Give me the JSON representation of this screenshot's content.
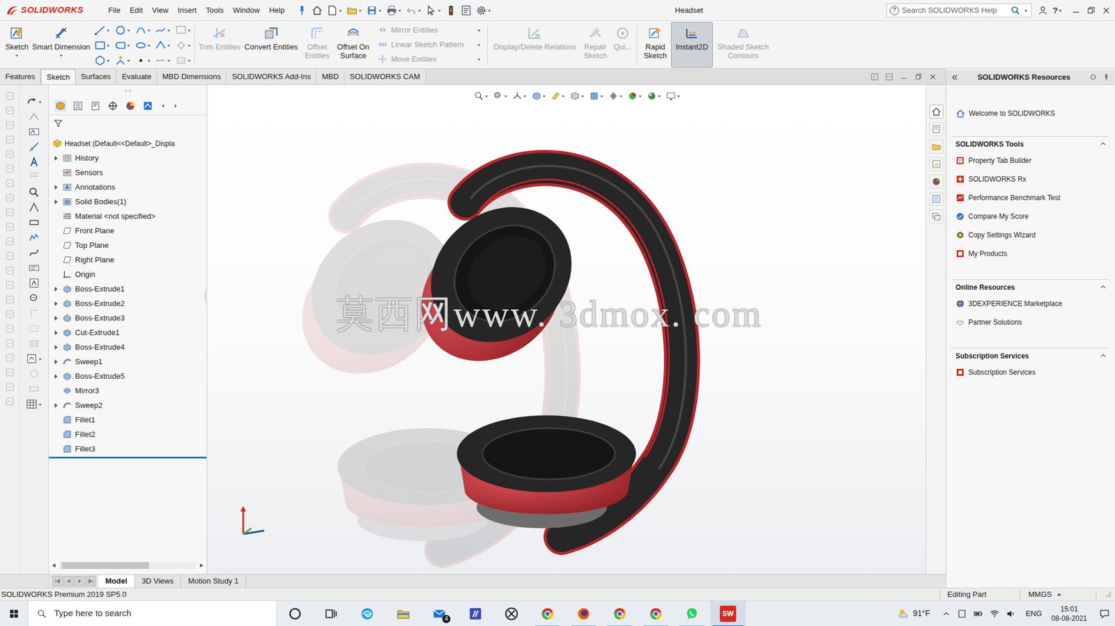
{
  "window": {
    "app": "SOLIDWORKS",
    "title": "Headset"
  },
  "menu": [
    "File",
    "Edit",
    "View",
    "Insert",
    "Tools",
    "Window",
    "Help"
  ],
  "search": {
    "placeholder": "Search SOLIDWORKS Help",
    "help_glyph": "?"
  },
  "top_bar": {
    "help_glyph": "?"
  },
  "ribbon": [
    {
      "label": "Sketch",
      "kind": "large",
      "disabled": false,
      "selected": false
    },
    {
      "label": "Smart Dimension",
      "kind": "large",
      "disabled": false,
      "selected": false
    },
    {
      "label": "",
      "kind": "icons",
      "disabled": false,
      "selected": false
    },
    {
      "label": "Trim Entities",
      "kind": "large",
      "disabled": true,
      "selected": false
    },
    {
      "label": "Convert Entities",
      "kind": "large",
      "disabled": false,
      "selected": false
    },
    {
      "label": "Offset Entities",
      "kind": "large",
      "disabled": true,
      "selected": false
    },
    {
      "label": "Offset On Surface",
      "kind": "large",
      "disabled": false,
      "selected": false
    },
    {
      "label": "Mirror Entities",
      "kind": "small",
      "disabled": true,
      "selected": false
    },
    {
      "label": "Linear Sketch Pattern",
      "kind": "small",
      "disabled": true,
      "selected": false
    },
    {
      "label": "Move Entities",
      "kind": "small",
      "disabled": true,
      "selected": false
    },
    {
      "label": "Display/Delete Relations",
      "kind": "large",
      "disabled": true,
      "selected": false
    },
    {
      "label": "Repair Sketch",
      "kind": "large",
      "disabled": true,
      "selected": false
    },
    {
      "label": "Qui...",
      "kind": "large",
      "disabled": true,
      "selected": false
    },
    {
      "label": "Rapid Sketch",
      "kind": "large",
      "disabled": false,
      "selected": false
    },
    {
      "label": "Instant2D",
      "kind": "large",
      "disabled": false,
      "selected": true
    },
    {
      "label": "Shaded Sketch Contours",
      "kind": "large",
      "disabled": true,
      "selected": false
    }
  ],
  "tabs": [
    {
      "label": "Features",
      "selected": false
    },
    {
      "label": "Sketch",
      "selected": true
    },
    {
      "label": "Surfaces",
      "selected": false
    },
    {
      "label": "Evaluate",
      "selected": false
    },
    {
      "label": "MBD Dimensions",
      "selected": false
    },
    {
      "label": "SOLIDWORKS Add-Ins",
      "selected": false
    },
    {
      "label": "MBD",
      "selected": false
    },
    {
      "label": "SOLIDWORKS CAM",
      "selected": false
    }
  ],
  "tree": {
    "root": "Headset (Default<<Default>_Displa",
    "items": [
      {
        "label": "History",
        "kind": "history",
        "expandable": true,
        "expanded": false
      },
      {
        "label": "Sensors",
        "kind": "sensors",
        "expandable": false,
        "expanded": false
      },
      {
        "label": "Annotations",
        "kind": "annotations",
        "expandable": true,
        "expanded": false
      },
      {
        "label": "Solid Bodies(1)",
        "kind": "bodies",
        "expandable": true,
        "expanded": false
      },
      {
        "label": "Material <not specified>",
        "kind": "material",
        "expandable": false,
        "expanded": false
      },
      {
        "label": "Front Plane",
        "kind": "plane",
        "expandable": false,
        "expanded": false
      },
      {
        "label": "Top Plane",
        "kind": "plane",
        "expandable": false,
        "expanded": false
      },
      {
        "label": "Right Plane",
        "kind": "plane",
        "expandable": false,
        "expanded": false
      },
      {
        "label": "Origin",
        "kind": "origin",
        "expandable": false,
        "expanded": false
      },
      {
        "label": "Boss-Extrude1",
        "kind": "extrude",
        "expandable": true,
        "expanded": false
      },
      {
        "label": "Boss-Extrude2",
        "kind": "extrude",
        "expandable": true,
        "expanded": false
      },
      {
        "label": "Boss-Extrude3",
        "kind": "extrude",
        "expandable": true,
        "expanded": false
      },
      {
        "label": "Cut-Extrude1",
        "kind": "cut",
        "expandable": true,
        "expanded": false
      },
      {
        "label": "Boss-Extrude4",
        "kind": "extrude",
        "expandable": true,
        "expanded": false
      },
      {
        "label": "Sweep1",
        "kind": "sweep",
        "expandable": true,
        "expanded": false
      },
      {
        "label": "Boss-Extrude5",
        "kind": "extrude",
        "expandable": true,
        "expanded": false
      },
      {
        "label": "Mirror3",
        "kind": "mirror",
        "expandable": false,
        "expanded": false
      },
      {
        "label": "Sweep2",
        "kind": "sweep",
        "expandable": true,
        "expanded": false
      },
      {
        "label": "Fillet1",
        "kind": "fillet",
        "expandable": false,
        "expanded": false
      },
      {
        "label": "Fillet2",
        "kind": "fillet",
        "expandable": false,
        "expanded": false
      },
      {
        "label": "Fillet3",
        "kind": "fillet",
        "expandable": false,
        "expanded": false
      }
    ]
  },
  "graphics": {
    "watermark": "莫西网www. 3dmox. com"
  },
  "resources": {
    "title": "SOLIDWORKS Resources",
    "welcome": "Welcome to SOLIDWORKS",
    "sections": [
      {
        "title": "SOLIDWORKS Tools",
        "expanded": true,
        "items": [
          "Property Tab Builder",
          "SOLIDWORKS Rx",
          "Performance Benchmark Test",
          "Compare My Score",
          "Copy Settings Wizard",
          "My Products"
        ]
      },
      {
        "title": "Online Resources",
        "expanded": true,
        "items": [
          "3DEXPERIENCE Marketplace",
          "Partner Solutions"
        ]
      },
      {
        "title": "Subscription Services",
        "expanded": true,
        "items": [
          "Subscription Services"
        ]
      }
    ]
  },
  "bottom_tabs": [
    {
      "label": "Model",
      "selected": true
    },
    {
      "label": "3D Views",
      "selected": false
    },
    {
      "label": "Motion Study 1",
      "selected": false
    }
  ],
  "status_bar": {
    "product": "SOLIDWORKS Premium 2019 SP5.0",
    "mode": "Editing Part",
    "units": "MMGS"
  },
  "taskbar": {
    "search_placeholder": "Type here to search",
    "mail_badge": "4",
    "sw_label": "SW",
    "weather": "91°F",
    "language": "ENG",
    "time": "15:01",
    "date": "08-08-2021"
  }
}
